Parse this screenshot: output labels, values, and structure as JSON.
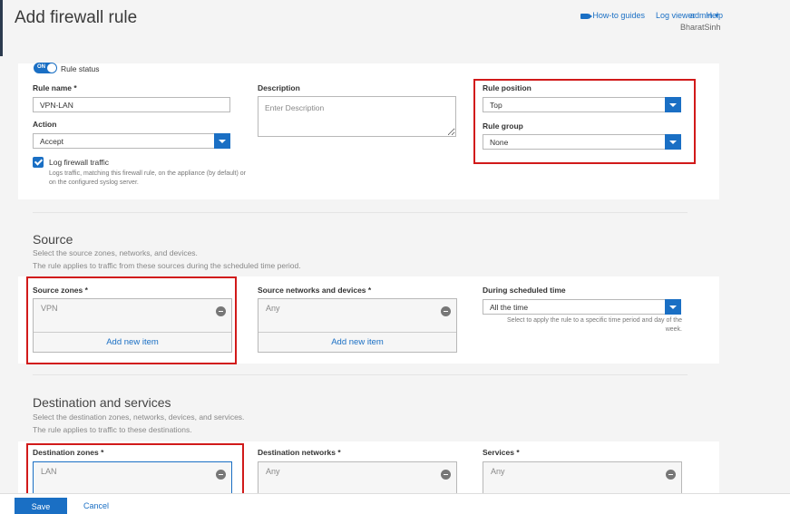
{
  "header": {
    "title": "Add firewall rule",
    "links": [
      "How-to guides",
      "Log viewer",
      "Help"
    ],
    "user": "admin",
    "user_sub": "BharatSinh"
  },
  "rule": {
    "status_label": "Rule status",
    "toggle_text": "ON",
    "name_label": "Rule name *",
    "name_value": "VPN-LAN",
    "action_label": "Action",
    "action_value": "Accept",
    "log_label": "Log firewall traffic",
    "log_hint": "Logs traffic, matching this firewall rule, on the appliance (by default) or on the configured syslog server.",
    "description_label": "Description",
    "description_placeholder": "Enter Description",
    "position_label": "Rule position",
    "position_value": "Top",
    "group_label": "Rule group",
    "group_value": "None"
  },
  "source": {
    "title": "Source",
    "desc1": "Select the source zones, networks, and devices.",
    "desc2": "The rule applies to traffic from these sources during the scheduled time period.",
    "zones_label": "Source zones *",
    "zones_value": "VPN",
    "networks_label": "Source networks and devices *",
    "networks_value": "Any",
    "add_new": "Add new item",
    "schedule_label": "During scheduled time",
    "schedule_value": "All the time",
    "schedule_hint": "Select to apply the rule to a specific time period and day of the week."
  },
  "destination": {
    "title": "Destination and services",
    "desc1": "Select the destination zones, networks, devices, and services.",
    "desc2": "The rule applies to traffic to these destinations.",
    "zones_label": "Destination zones *",
    "zones_value": "LAN",
    "networks_label": "Destination networks *",
    "networks_value": "Any",
    "services_label": "Services *",
    "services_value": "Any"
  },
  "footer": {
    "save": "Save",
    "cancel": "Cancel"
  },
  "colors": {
    "accent": "#1a6fc4",
    "highlight": "#d11a1a"
  }
}
